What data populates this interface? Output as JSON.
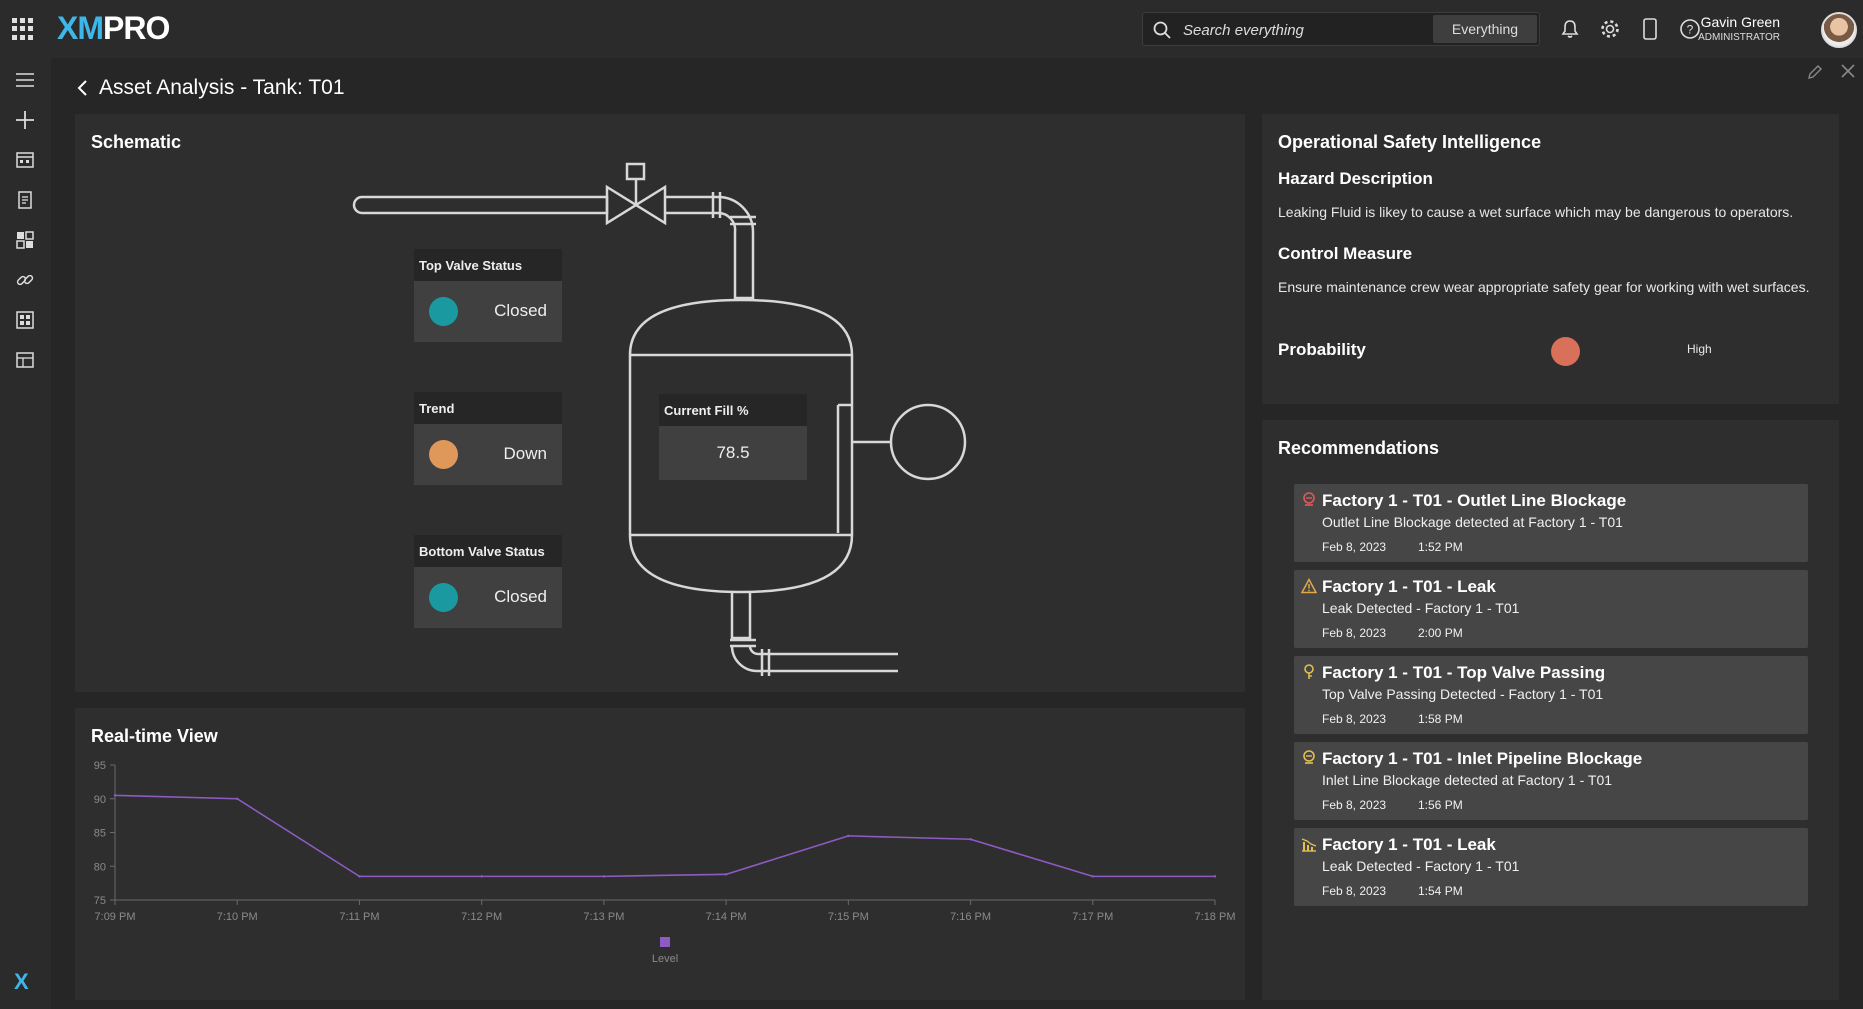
{
  "header": {
    "logo_left": "XM",
    "logo_right": "PRO",
    "search_placeholder": "Search everything",
    "search_scope": "Everything",
    "icons": [
      "bell-icon",
      "gear-icon",
      "mobile-icon",
      "help-icon"
    ],
    "user_name": "Gavin Green",
    "user_role": "ADMINISTRATOR"
  },
  "sidebar": {
    "icons": [
      "menu-icon",
      "plus-icon",
      "calendar-grid-icon",
      "document-icon",
      "dashboard-icon",
      "link-icon",
      "apps-grid-icon",
      "table-icon"
    ],
    "footer_icon": "xmpro-x-icon"
  },
  "page": {
    "title": "Asset Analysis - Tank:  T01"
  },
  "schematic": {
    "title": "Schematic",
    "top_valve": {
      "label": "Top Valve Status",
      "value": "Closed",
      "color": "#1a9aa0"
    },
    "trend": {
      "label": "Trend",
      "value": "Down",
      "color": "#e0975a"
    },
    "bottom_valve": {
      "label": "Bottom Valve Status",
      "value": "Closed",
      "color": "#1a9aa0"
    },
    "current_fill": {
      "label": "Current Fill %",
      "value": "78.5"
    }
  },
  "realtime": {
    "title": "Real-time View"
  },
  "chart_data": {
    "type": "line",
    "x": [
      "7:09 PM",
      "7:10 PM",
      "7:11 PM",
      "7:12 PM",
      "7:13 PM",
      "7:14 PM",
      "7:15 PM",
      "7:16 PM",
      "7:17 PM",
      "7:18 PM"
    ],
    "series": [
      {
        "name": "Level",
        "color": "#8e5bc4",
        "values": [
          90.5,
          90,
          78.5,
          78.5,
          78.5,
          78.8,
          84.5,
          84,
          78.5,
          78.5
        ]
      }
    ],
    "ylim": [
      75,
      95
    ],
    "yticks": [
      75,
      80,
      85,
      90,
      95
    ],
    "legend": "bottom-center"
  },
  "safety": {
    "title": "Operational Safety Intelligence",
    "hazard_heading": "Hazard Description",
    "hazard_text": "Leaking Fluid is likey to cause a wet surface which may be dangerous to operators.",
    "control_heading": "Control Measure",
    "control_text": "Ensure maintenance crew wear appropriate safety gear for working with wet surfaces.",
    "probability_label": "Probability",
    "probability_value": "High",
    "probability_color": "#d9705a"
  },
  "recommendations": {
    "title": "Recommendations",
    "items": [
      {
        "icon": "blockage-icon",
        "icon_color": "#e05a5a",
        "title": "Factory 1 - T01 - Outlet Line Blockage",
        "desc": "Outlet Line Blockage detected at Factory 1 - T01",
        "date": "Feb 8, 2023",
        "time": "1:52 PM"
      },
      {
        "icon": "warning-icon",
        "icon_color": "#e0a84a",
        "title": "Factory 1 - T01 - Leak",
        "desc": "Leak Detected - Factory 1 - T01",
        "date": "Feb 8, 2023",
        "time": "2:00 PM"
      },
      {
        "icon": "valve-icon",
        "icon_color": "#e0c050",
        "title": "Factory 1 - T01 - Top Valve Passing",
        "desc": "Top Valve Passing Detected - Factory 1 - T01",
        "date": "Feb 8, 2023",
        "time": "1:58 PM"
      },
      {
        "icon": "blockage-icon",
        "icon_color": "#e0c050",
        "title": "Factory 1 - T01 - Inlet Pipeline Blockage",
        "desc": "Inlet Line Blockage detected at Factory 1 - T01",
        "date": "Feb 8, 2023",
        "time": "1:56 PM"
      },
      {
        "icon": "trend-chart-icon",
        "icon_color": "#e0c050",
        "title": "Factory 1 - T01 - Leak",
        "desc": "Leak Detected - Factory 1 - T01",
        "date": "Feb 8, 2023",
        "time": "1:54 PM"
      }
    ]
  }
}
